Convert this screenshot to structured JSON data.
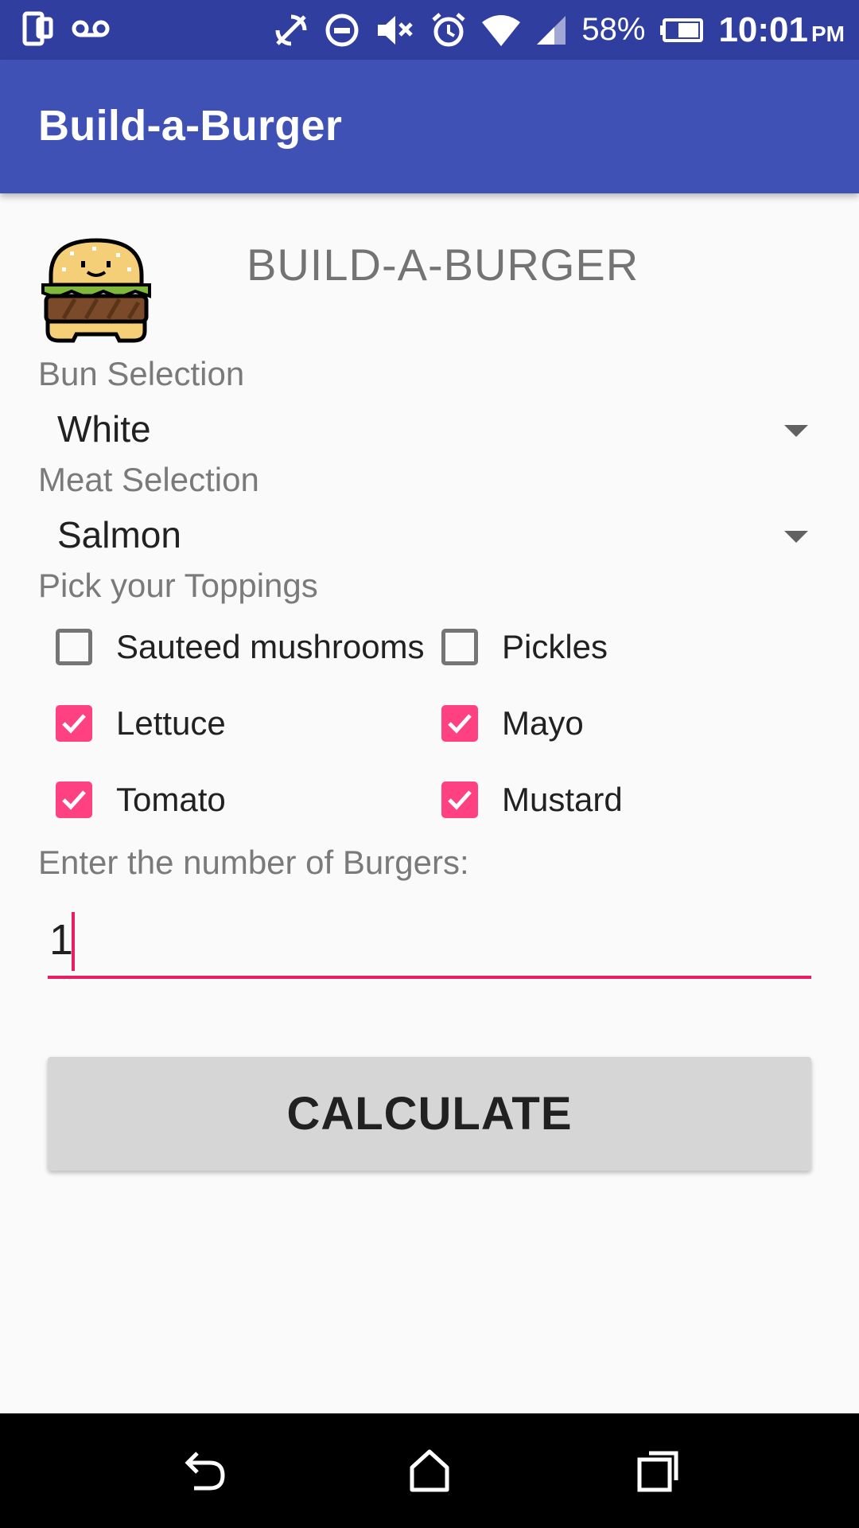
{
  "status_bar": {
    "battery_percent": "58%",
    "time": "10:01",
    "ampm": "PM",
    "icons": [
      "sim-icon",
      "voicemail-icon",
      "sync-off-icon",
      "do-not-disturb-icon",
      "mute-icon",
      "alarm-icon",
      "wifi-icon",
      "signal-icon",
      "battery-icon"
    ]
  },
  "app_bar": {
    "title": "Build-a-Burger"
  },
  "header": {
    "heading": "BUILD-A-BURGER",
    "logo": "burger-icon"
  },
  "bun": {
    "label": "Bun Selection",
    "value": "White"
  },
  "meat": {
    "label": "Meat Selection",
    "value": "Salmon"
  },
  "toppings": {
    "label": "Pick your Toppings",
    "items": [
      {
        "label": "Sauteed mushrooms",
        "checked": false
      },
      {
        "label": "Pickles",
        "checked": false
      },
      {
        "label": "Lettuce",
        "checked": true
      },
      {
        "label": "Mayo",
        "checked": true
      },
      {
        "label": "Tomato",
        "checked": true
      },
      {
        "label": "Mustard",
        "checked": true
      }
    ]
  },
  "quantity": {
    "label": "Enter the number of Burgers:",
    "value": "1"
  },
  "calculate": {
    "label": "CALCULATE"
  },
  "nav_bar": {
    "icons": [
      "back-icon",
      "home-icon",
      "recents-icon"
    ]
  },
  "colors": {
    "primary": "#3f51b5",
    "primary_dark": "#303f9f",
    "accent": "#ff4081"
  }
}
